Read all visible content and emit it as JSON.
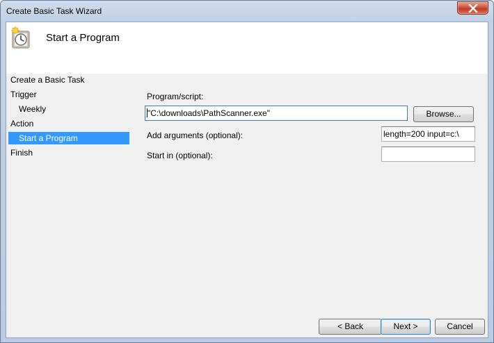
{
  "window": {
    "title": "Create Basic Task Wizard"
  },
  "header": {
    "title": "Start a Program",
    "icon": "task-scheduler-clock-icon"
  },
  "nav": {
    "items": [
      {
        "label": "Create a Basic Task",
        "level": 0,
        "selected": false
      },
      {
        "label": "Trigger",
        "level": 0,
        "selected": false
      },
      {
        "label": "Weekly",
        "level": 1,
        "selected": false
      },
      {
        "label": "Action",
        "level": 0,
        "selected": false
      },
      {
        "label": "Start a Program",
        "level": 1,
        "selected": true
      },
      {
        "label": "Finish",
        "level": 0,
        "selected": false
      }
    ]
  },
  "form": {
    "program_label": "Program/script:",
    "program_value": "\"C:\\downloads\\PathScanner.exe\"",
    "browse_label": "Browse...",
    "args_label": "Add arguments (optional):",
    "args_value": "length=200 input=c:\\",
    "startin_label": "Start in (optional):",
    "startin_value": ""
  },
  "footer": {
    "back_label": "< Back",
    "next_label": "Next >",
    "cancel_label": "Cancel"
  },
  "colors": {
    "selection": "#3399ff",
    "panel": "#f0f0f0",
    "close_button": "#c33a21"
  }
}
